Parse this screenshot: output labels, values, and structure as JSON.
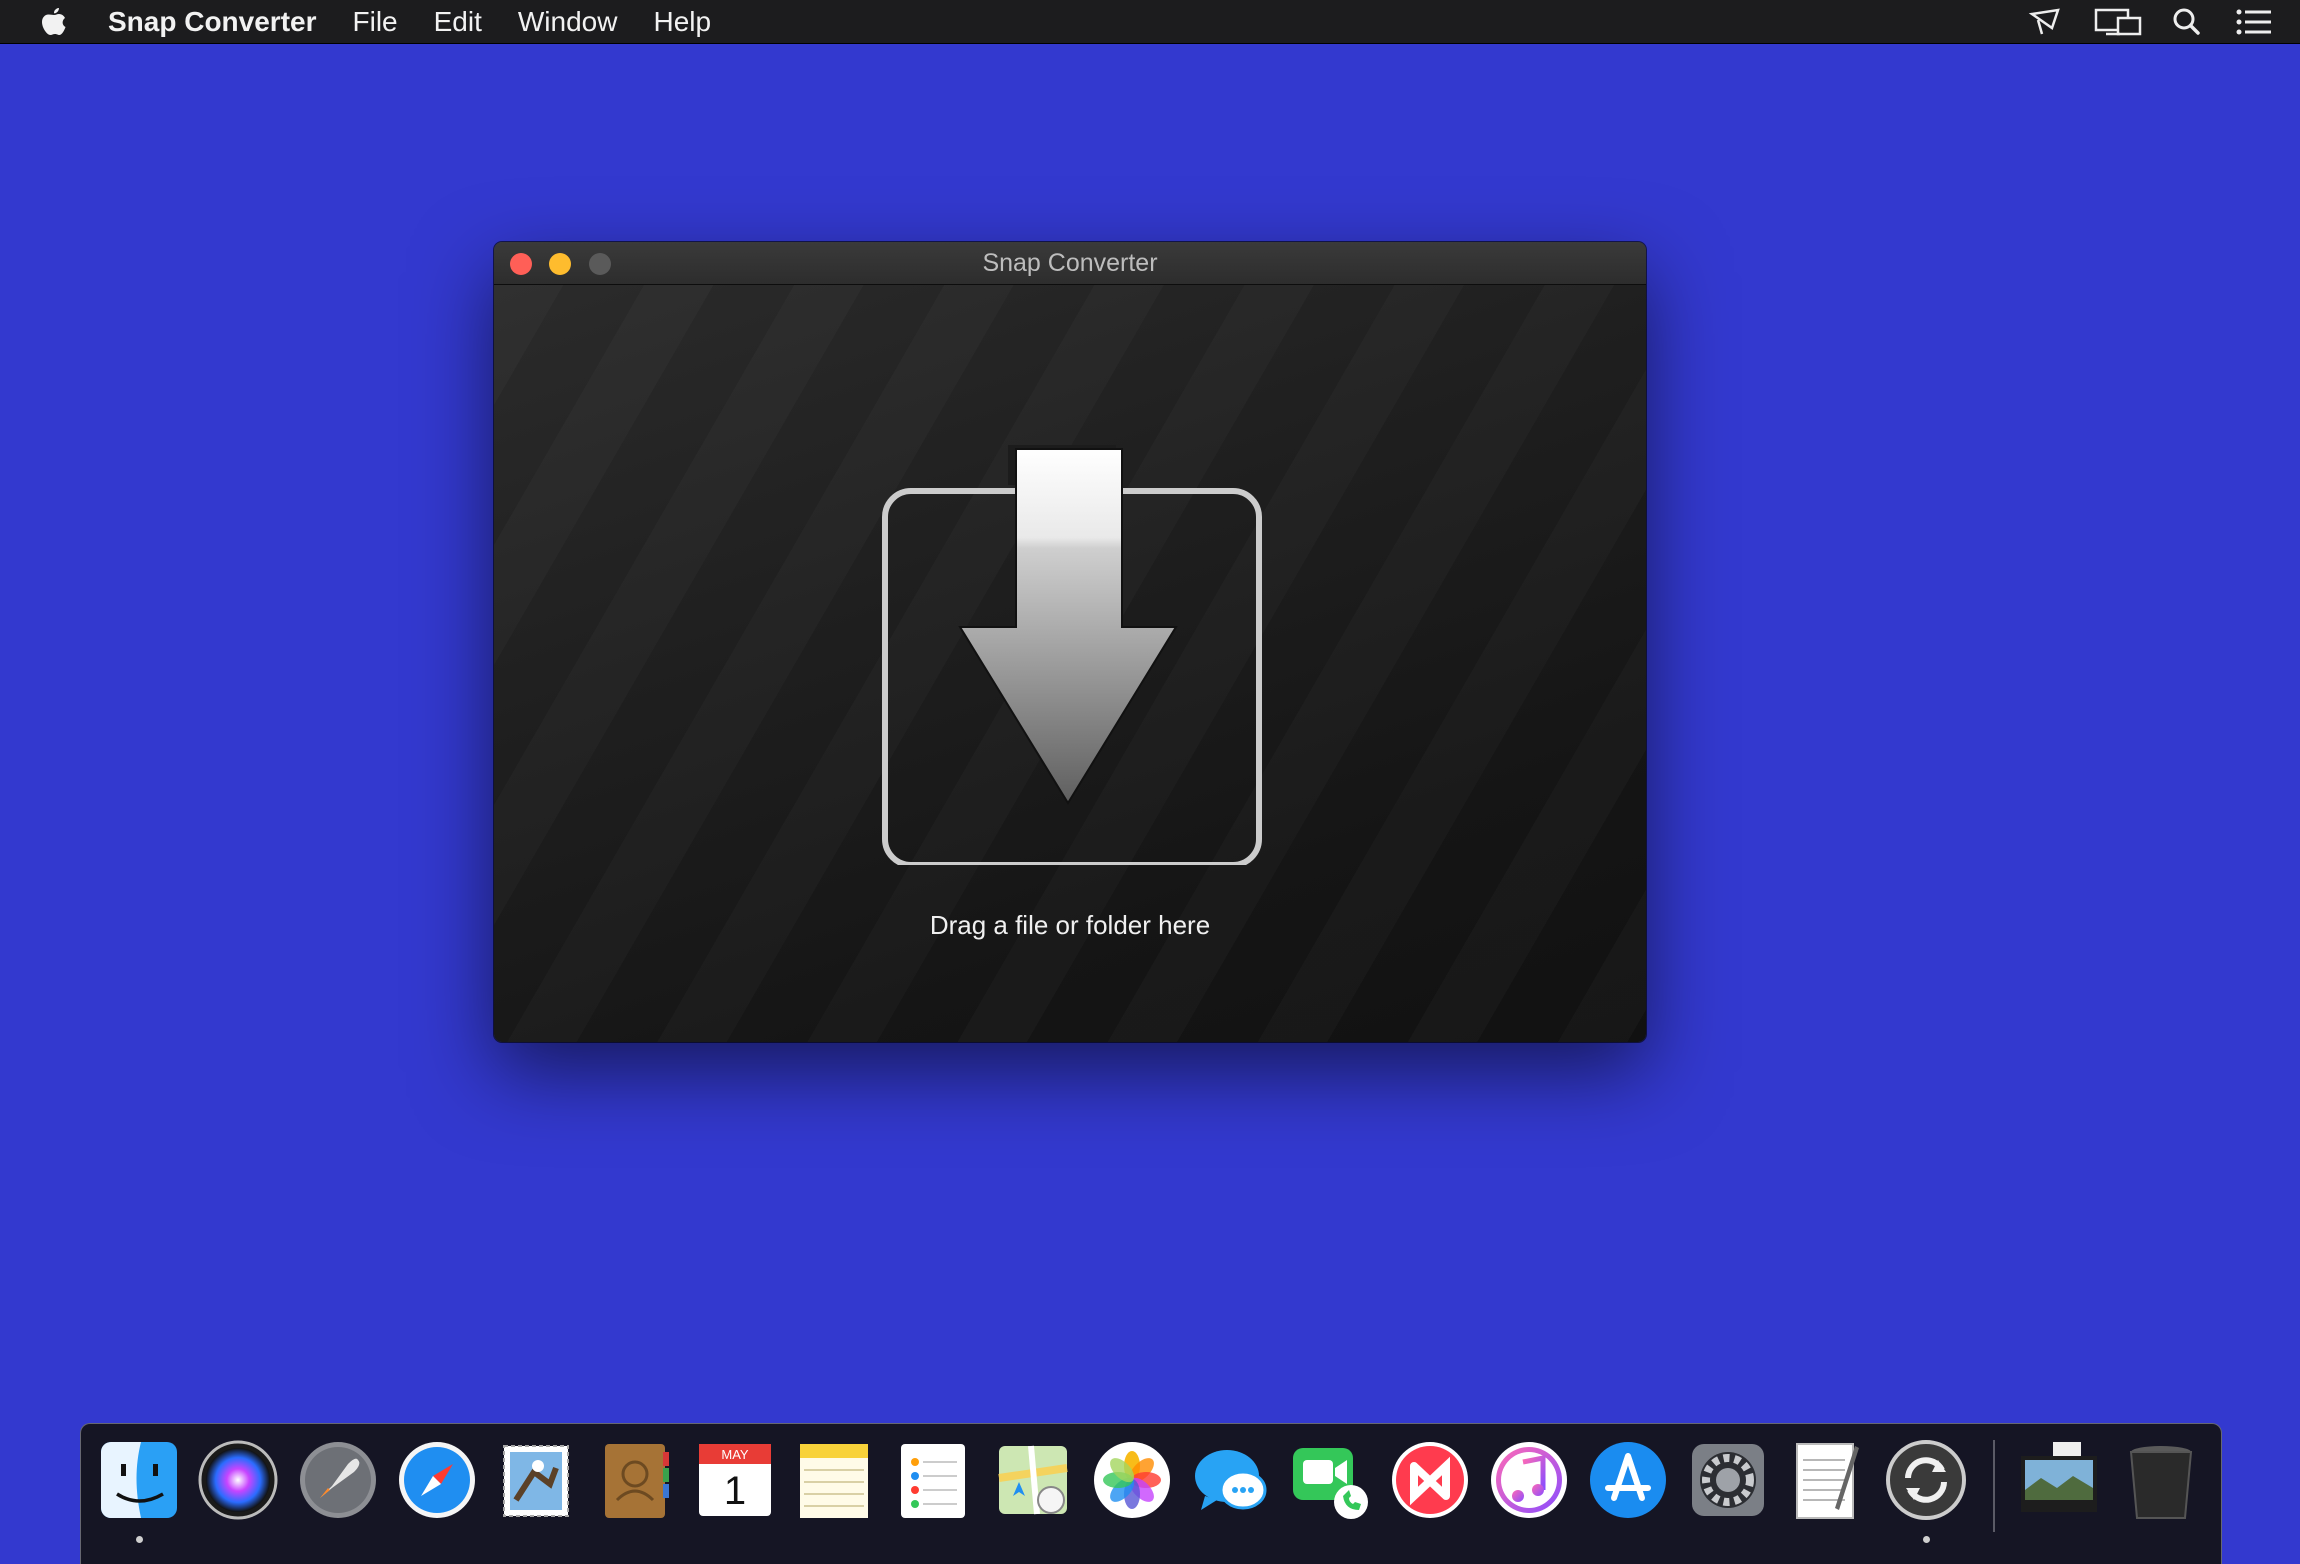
{
  "menubar": {
    "apple_icon": "apple-logo",
    "app_name": "Snap Converter",
    "items": [
      "File",
      "Edit",
      "Window",
      "Help"
    ],
    "status_icons": [
      "airplay-mirroring-icon",
      "display-icon",
      "spotlight-search-icon",
      "notification-center-icon"
    ]
  },
  "window": {
    "title": "Snap Converter",
    "drop_zone_icon": "download-arrow-into-tray-icon",
    "drop_label": "Drag a file or folder here"
  },
  "dock": {
    "apps": [
      "finder-icon",
      "siri-icon",
      "launchpad-icon",
      "safari-icon",
      "mail-icon",
      "contacts-icon",
      "calendar-icon",
      "notes-icon",
      "reminders-icon",
      "maps-icon",
      "photos-icon",
      "messages-icon",
      "facetime-icon",
      "news-icon",
      "itunes-icon",
      "app-store-icon",
      "system-preferences-icon",
      "textedit-icon",
      "snap-converter-icon"
    ],
    "calendar": {
      "month": "MAY",
      "day": "1"
    },
    "stack_icons": [
      "downloads-stack-icon",
      "trash-icon"
    ]
  },
  "colors": {
    "desktop": "#3339cf",
    "menubar": "#1c1c1e",
    "close": "#ff5f57",
    "minimize": "#febc2e"
  }
}
